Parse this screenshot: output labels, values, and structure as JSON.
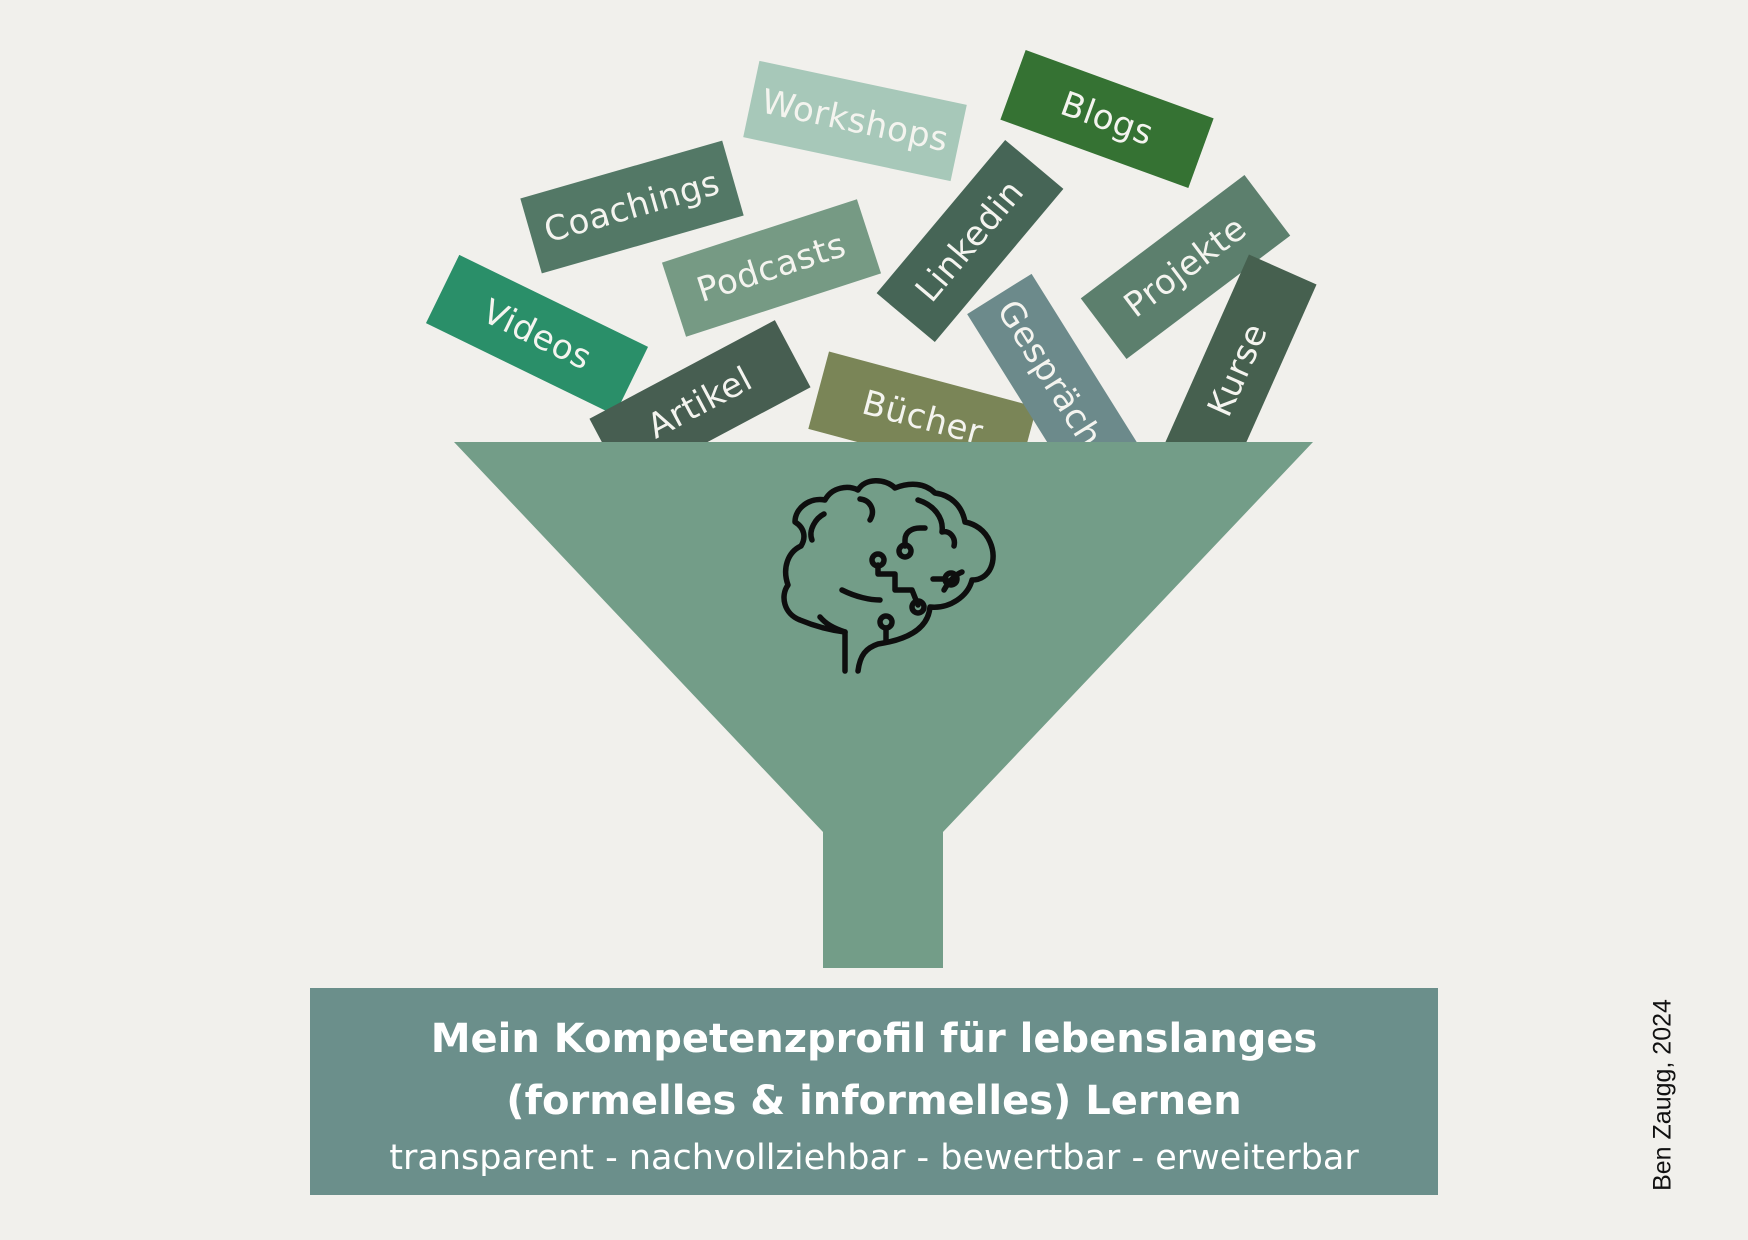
{
  "cards": [
    {
      "key": "workshops",
      "label": "Workshops",
      "color": "#a7c8b9"
    },
    {
      "key": "blogs",
      "label": "Blogs",
      "color": "#357233"
    },
    {
      "key": "coachings",
      "label": "Coachings",
      "color": "#537866"
    },
    {
      "key": "podcasts",
      "label": "Podcasts",
      "color": "#769a84"
    },
    {
      "key": "linkedin",
      "label": "Linkedin",
      "color": "#466556"
    },
    {
      "key": "projekte",
      "label": "Projekte",
      "color": "#5c7f6d"
    },
    {
      "key": "videos",
      "label": "Videos",
      "color": "#2a8f69"
    },
    {
      "key": "artikel",
      "label": "Artikel",
      "color": "#475e51"
    },
    {
      "key": "buecher",
      "label": "Bücher",
      "color": "#7a8557"
    },
    {
      "key": "gespraeche",
      "label": "Gespräche",
      "color": "#6c8a8b"
    },
    {
      "key": "kurse",
      "label": "Kurse",
      "color": "#46604f"
    }
  ],
  "funnel": {
    "color": "#739d88",
    "icon": "brain-circuit-icon"
  },
  "title": {
    "line1": "Mein Kompetenzprofil für lebenslanges",
    "line2": "(formelles & informelles) Lernen",
    "subtitle": "transparent - nachvollziehbar - bewertbar - erweiterbar"
  },
  "credit": "Ben Zaugg, 2024"
}
